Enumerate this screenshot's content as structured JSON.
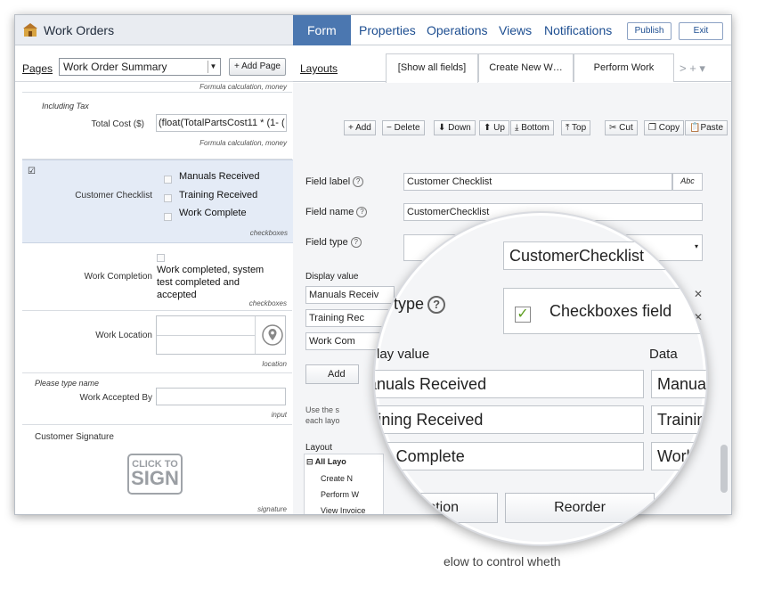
{
  "header": {
    "app_title": "Work Orders",
    "tabs": [
      {
        "label": "Form",
        "active": true
      },
      {
        "label": "Properties"
      },
      {
        "label": "Operations"
      },
      {
        "label": "Views"
      },
      {
        "label": "Notifications"
      }
    ],
    "publish_label": "Publish",
    "exit_label": "Exit"
  },
  "pages": {
    "label": "Pages",
    "selected": "Work Order Summary",
    "add_label": "Add Page"
  },
  "layouts": {
    "label": "Layouts",
    "tabs": [
      "[Show all fields]",
      "Create New W…",
      "Perform Work"
    ],
    "more": "> + ▾"
  },
  "toolbar": {
    "add": "Add",
    "delete": "Delete",
    "down": "Down",
    "up": "Up",
    "bottom": "Bottom",
    "top": "Top",
    "cut": "Cut",
    "copy": "Copy",
    "paste": "Paste"
  },
  "form": {
    "top_meta": "Formula calculation, money",
    "cost_hint": "Including Tax",
    "cost_label": "Total Cost ($)",
    "cost_formula": "(float(TotalPartsCost11 * (1- (",
    "cost_meta": "Formula calculation, money",
    "checklist_label": "Customer Checklist",
    "checklist_options": [
      "Manuals Received",
      "Training Received",
      "Work Complete"
    ],
    "checklist_meta": "checkboxes",
    "completion_label": "Work Completion",
    "completion_text": "Work completed, system test completed and accepted",
    "completion_meta": "checkboxes",
    "location_label": "Work Location",
    "location_meta": "location",
    "accepted_hint": "Please type name",
    "accepted_label": "Work Accepted By",
    "accepted_meta": "input",
    "signature_label": "Customer Signature",
    "signature_line1": "CLICK TO",
    "signature_line2": "SIGN",
    "signature_meta": "signature"
  },
  "properties": {
    "field_label_label": "Field label",
    "field_label_value": "Customer Checklist",
    "abc": "Abc",
    "field_name_label": "Field name",
    "field_name_value": "CustomerChecklist",
    "field_type_label": "Field type",
    "display_value_label": "Display value",
    "options": [
      "Manuals Receiv",
      "Training Rec",
      "Work Com"
    ],
    "add_partial": "Add",
    "use_text": "Use the s",
    "each_text": "each layo",
    "layout_label": "Layout",
    "layout_group": "All Layo",
    "layout_items": [
      "Create N",
      "Perform W",
      "View Invoice"
    ]
  },
  "magnifier": {
    "name_label_partial": "me",
    "field_name_value": "CustomerChecklist",
    "field_type_partial": "eld type",
    "field_type_value": "Checkboxes field",
    "display_value_label": "Display value",
    "data_label": "Data",
    "options": [
      "Manuals Received",
      "Training Received",
      "Work Complete"
    ],
    "data_values": [
      "Manual",
      "Training",
      "Work"
    ],
    "add_option": "Add Option",
    "reorder": "Reorder"
  },
  "footer_partial": "elow to control wheth"
}
